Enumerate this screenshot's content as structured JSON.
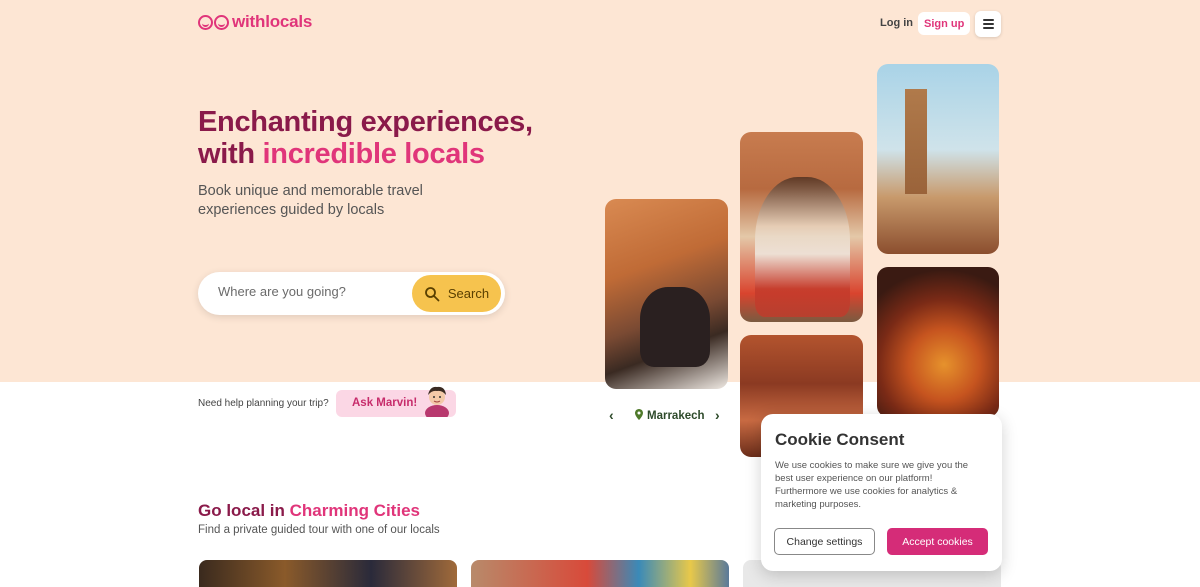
{
  "header": {
    "logo_text": "withlocals",
    "login_label": "Log in",
    "signup_label": "Sign up"
  },
  "hero": {
    "title_line1": "Enchanting experiences,",
    "title_line2_prefix": "with ",
    "title_line2_highlight": "incredible locals",
    "subtitle": "Book unique and memorable travel experiences guided by locals",
    "search_placeholder": "Where are you going?",
    "search_button": "Search"
  },
  "help": {
    "text": "Need help planning your trip?",
    "button_label": "Ask Marvin!"
  },
  "collage": {
    "city": "Marrakech"
  },
  "section": {
    "title_prefix": "Go local in ",
    "title_highlight": "Charming Cities",
    "subtitle": "Find a private guided tour with one of our locals"
  },
  "cookie": {
    "title": "Cookie Consent",
    "text": "We use cookies to make sure we give you the best user experience on our platform! Furthermore we use cookies for analytics & marketing purposes.",
    "settings_label": "Change settings",
    "accept_label": "Accept cookies"
  },
  "colors": {
    "brand_pink": "#e0357a",
    "brand_dark": "#8a1a4a",
    "hero_bg": "#fde6d4",
    "search_yellow": "#f6c34e"
  }
}
